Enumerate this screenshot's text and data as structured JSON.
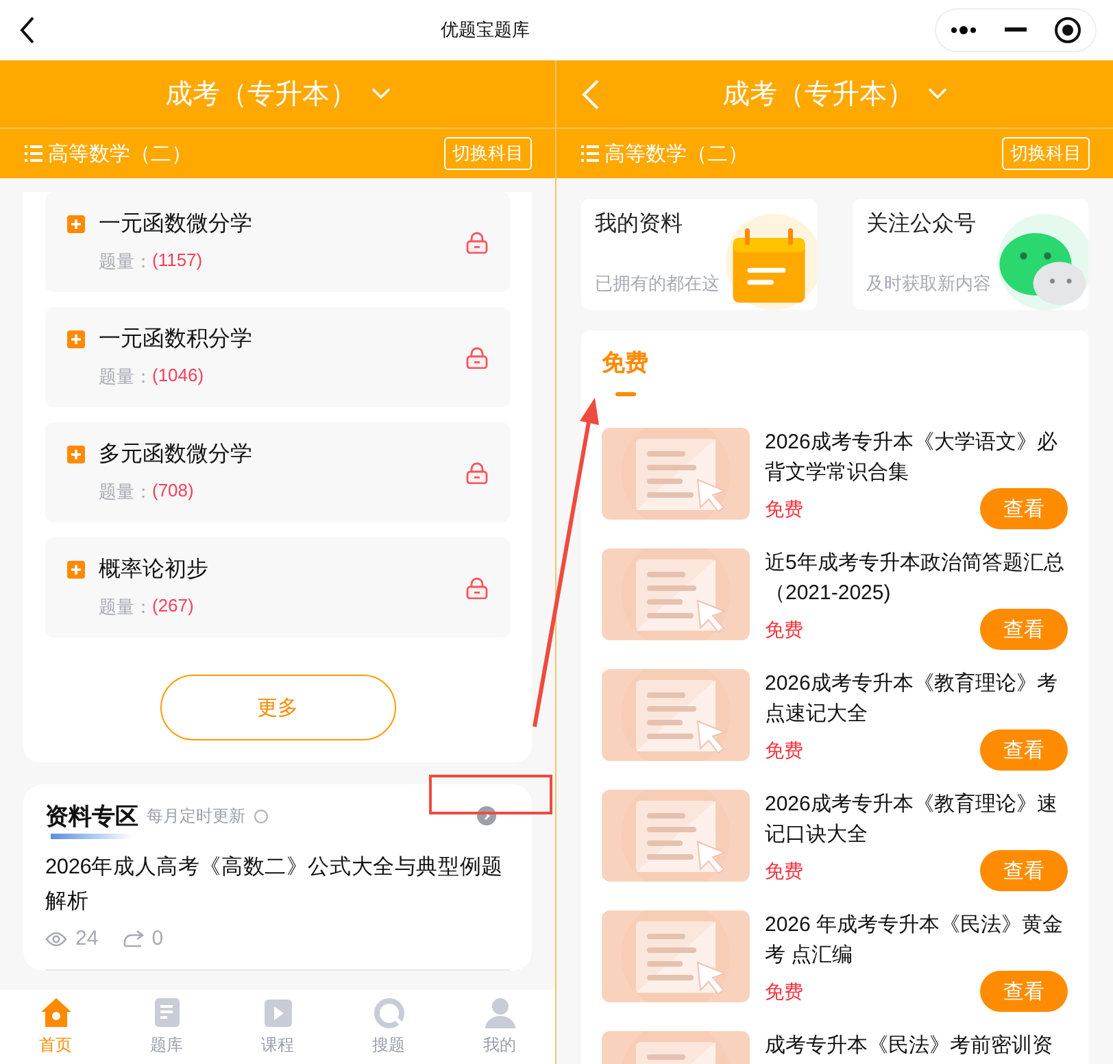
{
  "top_bar": {
    "title": "优题宝题库"
  },
  "left_pane": {
    "header": {
      "exam": "成考（专升本）",
      "subject": "高等数学（二）",
      "switch_button": "切换科目"
    },
    "chapters": [
      {
        "title": "一元函数微分学",
        "count_label": "题量：",
        "count": "(1157)",
        "locked": true
      },
      {
        "title": "一元函数积分学",
        "count_label": "题量：",
        "count": "(1046)",
        "locked": true
      },
      {
        "title": "多元函数微分学",
        "count_label": "题量：",
        "count": "(708)",
        "locked": true
      },
      {
        "title": "概率论初步",
        "count_label": "题量：",
        "count": "(267)",
        "locked": true
      }
    ],
    "more_button": "更多",
    "materials": {
      "title": "资料专区",
      "subtitle": "每月定时更新",
      "article": {
        "title": "2026年成人高考《高数二》公式大全与典型例题解析",
        "views": "24",
        "shares": "0"
      }
    },
    "bottom_nav": [
      {
        "label": "首页",
        "kind": "home",
        "selected": true
      },
      {
        "label": "题库",
        "kind": "bank",
        "selected": false
      },
      {
        "label": "课程",
        "kind": "course",
        "selected": false
      },
      {
        "label": "搜题",
        "kind": "search",
        "selected": false
      },
      {
        "label": "我的",
        "kind": "profile",
        "selected": false
      }
    ]
  },
  "right_pane": {
    "header": {
      "exam": "成考（专升本）",
      "subject": "高等数学（二）",
      "switch_button": "切换科目"
    },
    "shortcuts": [
      {
        "title": "我的资料",
        "subtitle": "已拥有的都在这",
        "kind": "calendar"
      },
      {
        "title": "关注公众号",
        "subtitle": "及时获取新内容",
        "kind": "chat"
      }
    ],
    "free_section": {
      "tab": "免费",
      "items": [
        {
          "title": "2026成考专升本《大学语文》必背文学常识合集",
          "price": "免费",
          "button": "查看"
        },
        {
          "title": "近5年成考专升本政治简答题汇总（2021-2025)",
          "price": "免费",
          "button": "查看"
        },
        {
          "title": "2026成考专升本《教育理论》考点速记大全",
          "price": "免费",
          "button": "查看"
        },
        {
          "title": "2026成考专升本《教育理论》速记口诀大全",
          "price": "免费",
          "button": "查看"
        },
        {
          "title": "2026 年成考专升本《民法》黄金考 点汇编",
          "price": "免费",
          "button": "查看"
        },
        {
          "title": "成考专升本《民法》考前密训资"
        }
      ]
    }
  }
}
